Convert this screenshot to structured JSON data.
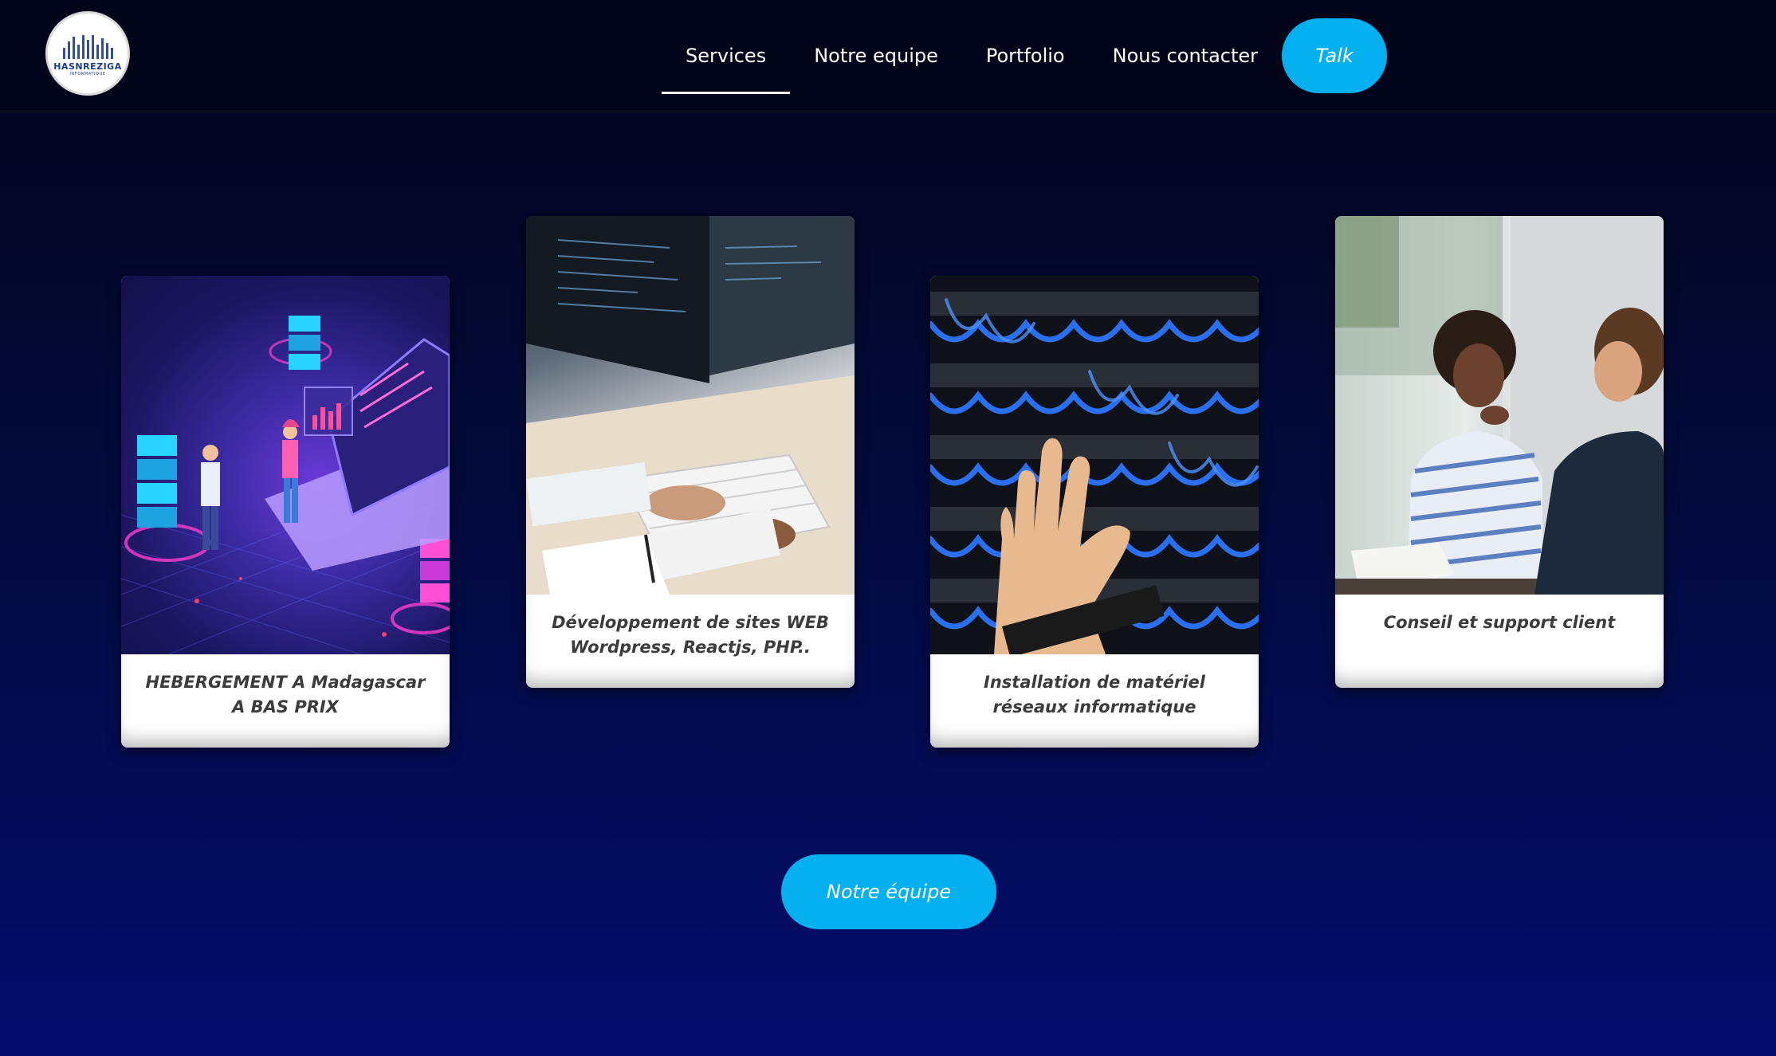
{
  "logo": {
    "name": "HASNREZIGA",
    "subtitle": "INFORMATIQUE"
  },
  "nav": {
    "items": [
      {
        "label": "Services",
        "active": true
      },
      {
        "label": "Notre equipe",
        "active": false
      },
      {
        "label": "Portfolio",
        "active": false
      },
      {
        "label": "Nous contacter",
        "active": false
      }
    ],
    "cta_label": "Talk"
  },
  "services": [
    {
      "caption": "HEBERGEMENT A Madagascar A BAS PRIX",
      "image": "hosting-illustration"
    },
    {
      "caption": "Développement de sites WEB Wordpress, Reactjs, PHP..",
      "image": "developer-photo"
    },
    {
      "caption": "Installation de matériel réseaux informatique",
      "image": "network-cables-photo"
    },
    {
      "caption": "Conseil et support client",
      "image": "consulting-photo"
    }
  ],
  "team_button_label": "Notre équipe",
  "colors": {
    "accent": "#04b0f0",
    "background_top": "#02041a",
    "background_bottom": "#040d6e",
    "card_text": "#3c3c3c"
  }
}
